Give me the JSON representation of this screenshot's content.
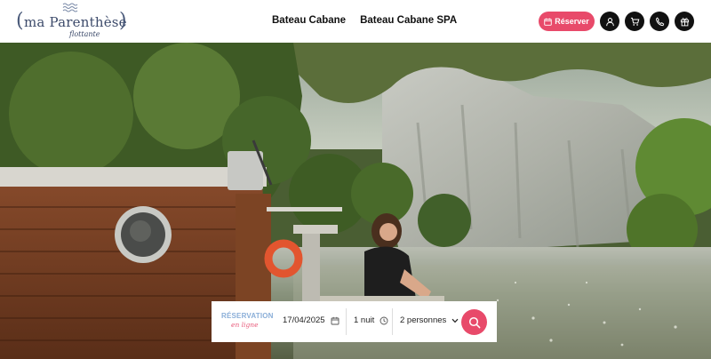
{
  "logo": {
    "brand": "ma Parenthèse",
    "subtitle": "flottante",
    "paren_left": "(",
    "paren_right": ")",
    "icon": "waves-icon"
  },
  "nav": {
    "items": [
      {
        "label": "Bateau Cabane"
      },
      {
        "label": "Bateau Cabane SPA"
      }
    ]
  },
  "actions": {
    "book_label": "Réserver",
    "icons": [
      "user-icon",
      "cart-icon",
      "phone-icon",
      "gift-icon"
    ]
  },
  "colors": {
    "accent": "#e84a6a",
    "reservation_title": "#8aaed8",
    "dark_button": "#111111"
  },
  "reservation": {
    "title": "RÉSERVATION",
    "subtitle": "en ligne",
    "date": "17/04/2025",
    "nights": "1 nuit",
    "guests": "2 personnes"
  }
}
